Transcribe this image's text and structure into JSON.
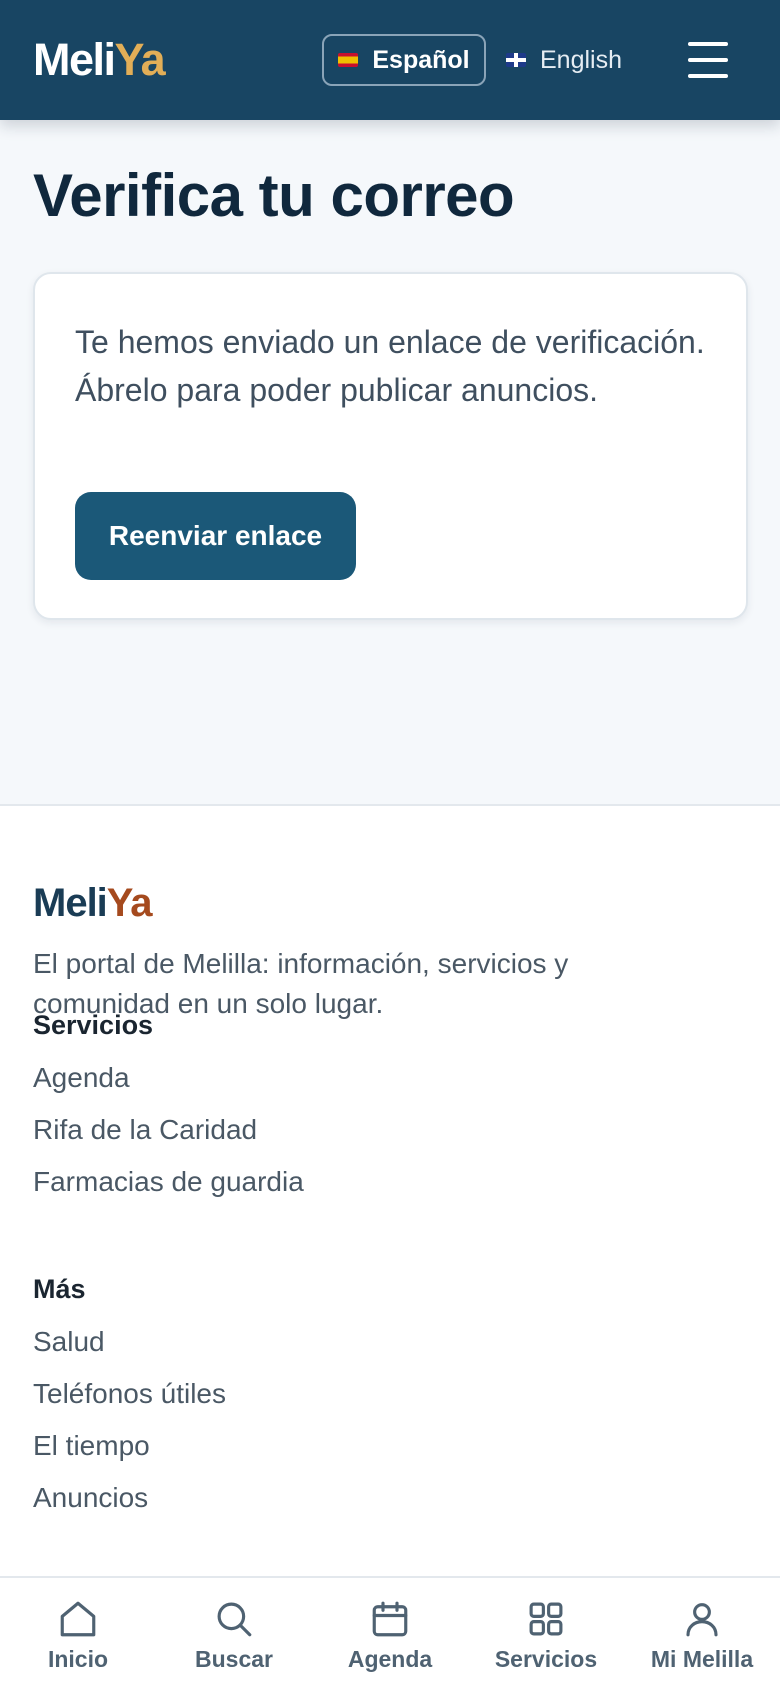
{
  "header": {
    "logo_part1": "Meli",
    "logo_part2": "Ya",
    "lang_es_label": "Español",
    "lang_en_label": "English",
    "menu_icon": "hamburger-menu-icon"
  },
  "main": {
    "title": "Verifica tu correo",
    "message": "Te hemos enviado un enlace de verificación. Ábrelo para poder publicar anuncios.",
    "resend_button": "Reenviar enlace"
  },
  "footer": {
    "logo_part1": "Meli",
    "logo_part2": "Ya",
    "tagline": "El portal de Melilla: información, servicios y comunidad en un solo lugar.",
    "sections": [
      {
        "heading": "Servicios",
        "links": [
          "Agenda",
          "Rifa de la Caridad",
          "Farmacias de guardia"
        ]
      },
      {
        "heading": "Más",
        "links": [
          "Salud",
          "Teléfonos útiles",
          "El tiempo",
          "Anuncios"
        ]
      }
    ]
  },
  "bottom_nav": {
    "items": [
      {
        "label": "Inicio",
        "icon": "home-icon"
      },
      {
        "label": "Buscar",
        "icon": "search-icon"
      },
      {
        "label": "Agenda",
        "icon": "calendar-icon"
      },
      {
        "label": "Servicios",
        "icon": "grid-icon"
      },
      {
        "label": "Mi Melilla",
        "icon": "user-icon"
      }
    ]
  },
  "colors": {
    "header_bg": "#184563",
    "logo_accent": "#e2ae57",
    "button_bg": "#1b5878",
    "footer_logo_accent": "#a54a1e"
  }
}
